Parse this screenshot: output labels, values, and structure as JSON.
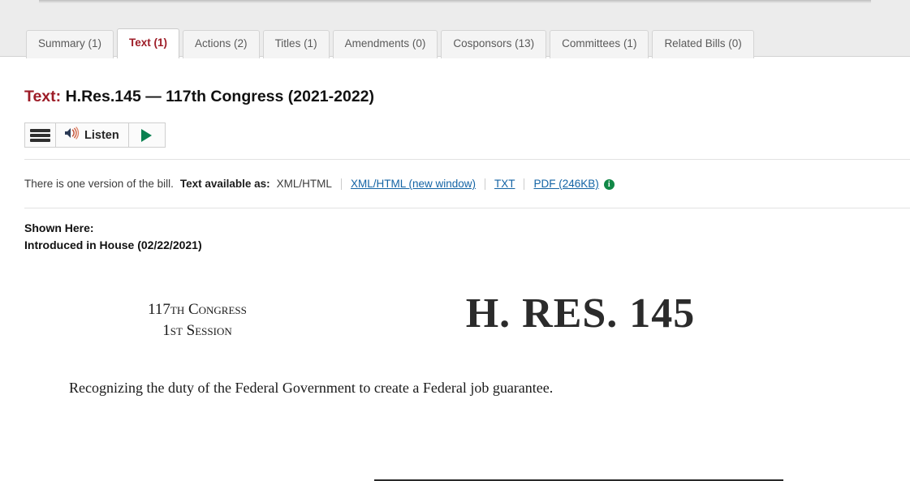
{
  "tabs": [
    {
      "label": "Summary (1)",
      "active": false
    },
    {
      "label": "Text (1)",
      "active": true
    },
    {
      "label": "Actions (2)",
      "active": false
    },
    {
      "label": "Titles (1)",
      "active": false
    },
    {
      "label": "Amendments (0)",
      "active": false
    },
    {
      "label": "Cosponsors (13)",
      "active": false
    },
    {
      "label": "Committees (1)",
      "active": false
    },
    {
      "label": "Related Bills (0)",
      "active": false
    }
  ],
  "page": {
    "title_label": "Text:",
    "title_value": "H.Res.145 — 117th Congress (2021-2022)"
  },
  "listen_widget": {
    "menu_icon": "hamburger-menu-icon",
    "speaker_icon": "speaker-sound-icon",
    "listen_label": "Listen",
    "play_icon": "play-triangle-icon"
  },
  "versions": {
    "version_note": "There is one version of the bill.",
    "available_label": "Text available as:",
    "current_format": "XML/HTML",
    "links": [
      "XML/HTML (new window)",
      "TXT",
      "PDF (246KB)"
    ],
    "info_icon_label": "i"
  },
  "shown_here": {
    "heading": "Shown Here:",
    "value": "Introduced in House (02/22/2021)"
  },
  "document": {
    "congress_line1": "117th Congress",
    "congress_line2": "1st Session",
    "bill_number": "H. RES. 145",
    "description": "Recognizing the duty of the Federal Government to create a Federal job guarantee."
  },
  "colors": {
    "accent_red": "#9d1c27",
    "link_blue": "#1464a5",
    "info_green": "#118847",
    "play_green": "#0a8050",
    "band_gray": "#ececec"
  }
}
